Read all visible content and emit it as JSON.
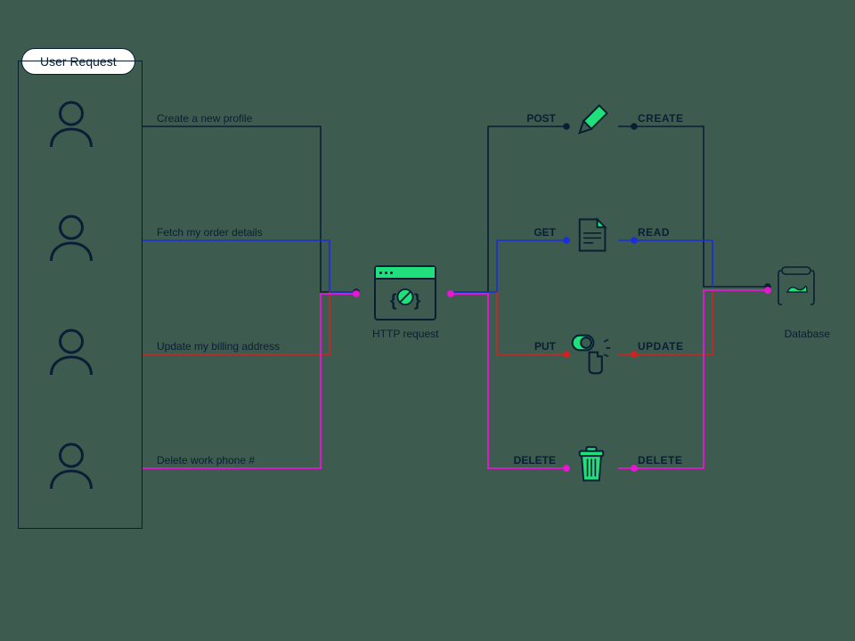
{
  "title": "User Request",
  "center_label": "HTTP request",
  "db_label": "Database",
  "colors": {
    "create": "#0a1f33",
    "read": "#1a2ee0",
    "update": "#d62020",
    "delete": "#e815d3"
  },
  "rows": [
    {
      "action": "Create a new profile",
      "method": "POST",
      "crud": "CREATE",
      "color_key": "create"
    },
    {
      "action": "Fetch my order details",
      "method": "GET",
      "crud": "READ",
      "color_key": "read"
    },
    {
      "action": "Update my billing address",
      "method": "PUT",
      "crud": "UPDATE",
      "color_key": "update"
    },
    {
      "action": "Delete work phone #",
      "method": "DELETE",
      "crud": "DELETE",
      "color_key": "delete"
    }
  ]
}
